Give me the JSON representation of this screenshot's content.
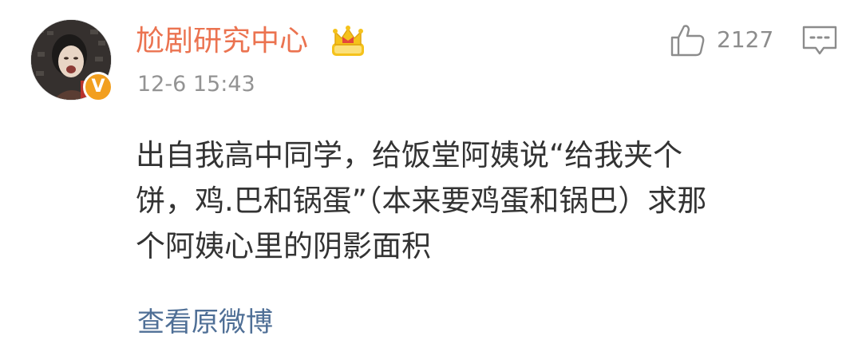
{
  "comment": {
    "username": "尬剧研究中心",
    "timestamp": "12-6 15:43",
    "like_count": "2127",
    "content_lines": [
      "出自我高中同学，给饭堂阿姨说“给我夹个",
      "饼，鸡.巴和锅蛋”（本来要鸡蛋和锅巴）求那",
      "个阿姨心里的阴影面积"
    ],
    "view_original_label": "查看原微博",
    "verified_badge_text": "V"
  },
  "icons": {
    "avatar": "user-avatar-photo",
    "verified": "verified-v-badge-icon",
    "member": "crown-icon",
    "like": "thumbs-up-icon",
    "comment": "comment-bubble-icon"
  },
  "colors": {
    "username": "#eb7350",
    "timestamp": "#939393",
    "content": "#333333",
    "link": "#4f6f96",
    "icon_gray": "#8c8c8c",
    "badge_orange": "#f29f1f",
    "crown_gold": "#f5c21b",
    "crown_red": "#e5483b"
  }
}
